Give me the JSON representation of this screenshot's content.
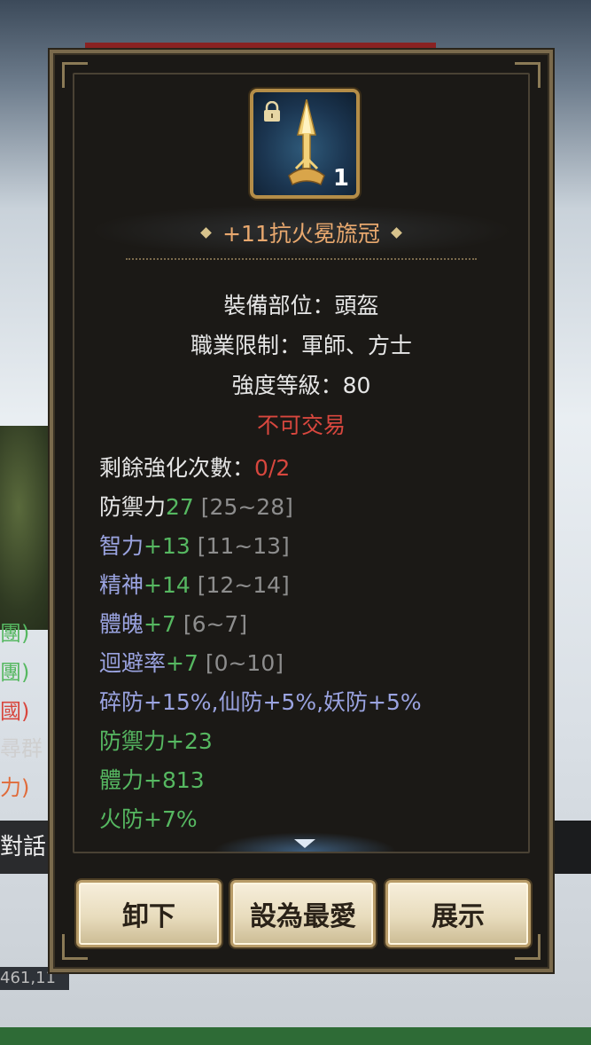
{
  "background": {
    "chat_fragments": [
      {
        "text": "團)",
        "color": "#56b861"
      },
      {
        "text": "團)",
        "color": "#56b861"
      },
      {
        "text": "國)",
        "color": "#d8473e"
      },
      {
        "text": "尋群",
        "color": "#cfcfcf"
      },
      {
        "text": "力)",
        "color": "#e06b3a"
      }
    ],
    "dialog_tab": "對話",
    "coords": "461,11"
  },
  "item": {
    "icon": "spear-helmet-icon",
    "locked": true,
    "quantity": "1",
    "name": "+11抗火冕旒冠"
  },
  "info": {
    "slot": "裝備部位：頭盔",
    "class_restriction": "職業限制：軍師、方士",
    "strength_level": "強度等級：80",
    "trade_status": "不可交易"
  },
  "stats": {
    "enhance_label": "剩餘強化次數：",
    "enhance_value": "0/2",
    "defense_label": "防禦力",
    "defense_value": "27",
    "defense_range": "[25~28]",
    "int_label": "智力",
    "int_value": "+13",
    "int_range": "[11~13]",
    "spirit_label": "精神",
    "spirit_value": "+14",
    "spirit_range": "[12~14]",
    "physique_label": "體魄",
    "physique_value": "+7",
    "physique_range": "[6~7]",
    "evasion_label": "迴避率",
    "evasion_value": "+7",
    "evasion_range": "[0~10]",
    "resist_line": "碎防+15%,仙防+5%,妖防+5%",
    "bonus_defense": "防禦力+23",
    "bonus_hp": "體力+813",
    "bonus_fire": "火防+7%"
  },
  "buttons": {
    "unequip": "卸下",
    "favorite": "設為最愛",
    "show": "展示"
  },
  "colors": {
    "name": "#e8a86e",
    "red": "#d8473e",
    "green": "#56b861",
    "purple": "#9aa3e0",
    "gray": "#8d8d8d"
  }
}
